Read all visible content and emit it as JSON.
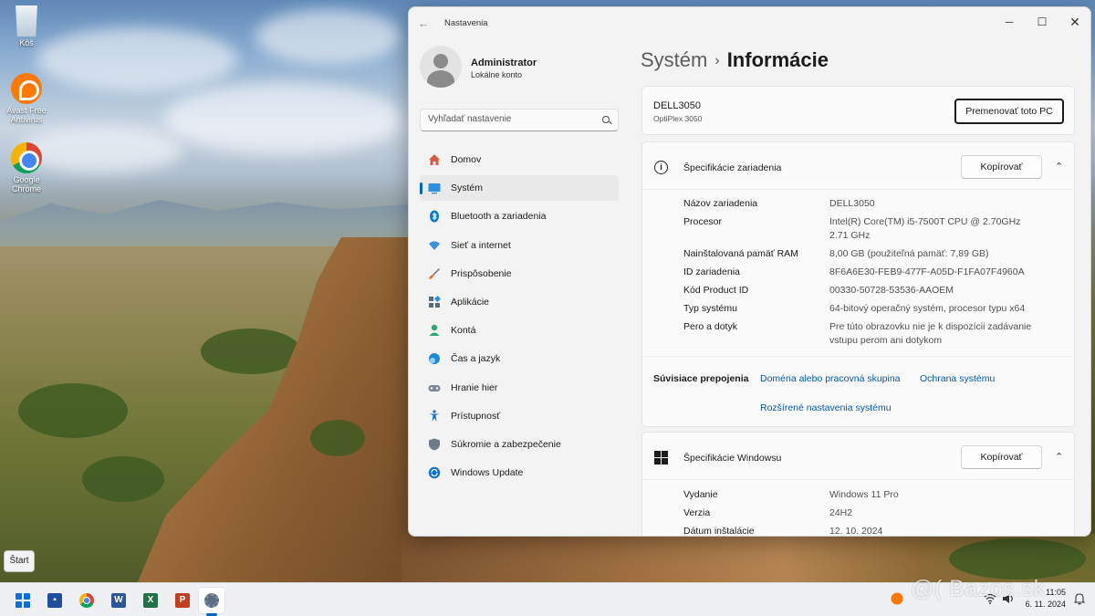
{
  "desktop": {
    "icons": [
      {
        "label": "Kôš"
      },
      {
        "label": "Avast Free Antivirus"
      },
      {
        "label": "Google Chrome"
      }
    ],
    "start_tooltip": "Štart",
    "watermark": "@( Bazos.sk"
  },
  "window": {
    "title": "Nastavenia",
    "controls": {
      "minimize": "─",
      "maximize": "☐",
      "close": "✕"
    }
  },
  "account": {
    "name": "Administrator",
    "type": "Lokálne konto"
  },
  "search": {
    "placeholder": "Vyhľadať nastavenie"
  },
  "sidebar": {
    "items": [
      {
        "label": "Domov",
        "icon": "home-icon",
        "color": "#d9593d"
      },
      {
        "label": "Systém",
        "icon": "system-icon",
        "color": "#0067c0",
        "active": true
      },
      {
        "label": "Bluetooth a zariadenia",
        "icon": "bluetooth-icon",
        "color": "#0078d4"
      },
      {
        "label": "Sieť a internet",
        "icon": "wifi-icon",
        "color": "#3a8ede"
      },
      {
        "label": "Prispôsobenie",
        "icon": "brush-icon",
        "color": "#e3753a"
      },
      {
        "label": "Aplikácie",
        "icon": "apps-icon",
        "color": "#5b6b80"
      },
      {
        "label": "Kontá",
        "icon": "account-icon",
        "color": "#2aa876"
      },
      {
        "label": "Čas a jazyk",
        "icon": "globe-icon",
        "color": "#1e88d8"
      },
      {
        "label": "Hranie hier",
        "icon": "gamepad-icon",
        "color": "#7a8595"
      },
      {
        "label": "Prístupnosť",
        "icon": "accessibility-icon",
        "color": "#1a73c9"
      },
      {
        "label": "Súkromie a zabezpečenie",
        "icon": "shield-icon",
        "color": "#6f7a88"
      },
      {
        "label": "Windows Update",
        "icon": "update-icon",
        "color": "#0a6fd6"
      }
    ]
  },
  "breadcrumb": {
    "parent": "Systém",
    "separator": "›",
    "current": "Informácie"
  },
  "pc": {
    "name": "DELL3050",
    "model": "OptiPlex 3050",
    "rename_label": "Premenovať toto PC"
  },
  "device_specs": {
    "title": "Špecifikácie zariadenia",
    "copy_label": "Kopírovať",
    "rows": [
      {
        "key": "Názov zariadenia",
        "value": "DELL3050"
      },
      {
        "key": "Procesor",
        "value": "Intel(R) Core(TM) i5-7500T CPU @ 2.70GHz 2.71 GHz"
      },
      {
        "key": "Nainštalovaná pamäť RAM",
        "value": "8,00 GB (použiteľná pamäť: 7,89 GB)"
      },
      {
        "key": "ID zariadenia",
        "value": "8F6A6E30-FEB9-477F-A05D-F1FA07F4960A"
      },
      {
        "key": "Kód Product ID",
        "value": "00330-50728-53536-AAOEM"
      },
      {
        "key": "Typ systému",
        "value": "64-bitový operačný systém, procesor typu x64"
      },
      {
        "key": "Pero a dotyk",
        "value": "Pre túto obrazovku nie je k dispozícii zadávanie vstupu perom ani dotykom"
      }
    ],
    "related_label": "Súvisiace prepojenia",
    "related_links": [
      "Doména alebo pracovná skupina",
      "Ochrana systému",
      "Rozšírené nastavenia systému"
    ]
  },
  "windows_specs": {
    "title": "Špecifikácie Windowsu",
    "copy_label": "Kopírovať",
    "rows": [
      {
        "key": "Vydanie",
        "value": "Windows 11 Pro"
      },
      {
        "key": "Verzia",
        "value": "24H2"
      },
      {
        "key": "Dátum inštalácie",
        "value": "12. 10. 2024"
      }
    ]
  },
  "taskbar": {
    "apps": [
      {
        "name": "start",
        "icon": "windows-start-icon"
      },
      {
        "name": "save",
        "icon": "save-icon",
        "color": "#1f4e9e"
      },
      {
        "name": "chrome",
        "icon": "chrome-icon"
      },
      {
        "name": "word",
        "icon": "word-icon",
        "glyph": "W",
        "color": "#2b579a"
      },
      {
        "name": "excel",
        "icon": "excel-icon",
        "glyph": "X",
        "color": "#217346"
      },
      {
        "name": "powerpoint",
        "icon": "powerpoint-icon",
        "glyph": "P",
        "color": "#c43e1c"
      },
      {
        "name": "settings",
        "icon": "settings-gear-icon",
        "active": true
      }
    ],
    "clock": {
      "time": "11:05",
      "date": "6. 11. 2024"
    }
  }
}
